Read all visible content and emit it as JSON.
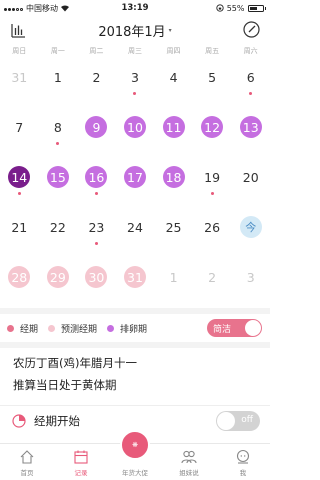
{
  "status_bar": {
    "carrier": "中国移动",
    "time": "13:19",
    "battery": "55%"
  },
  "header": {
    "title": "2018年1月",
    "caret": "▾"
  },
  "weekdays": [
    "周日",
    "周一",
    "周二",
    "周三",
    "周四",
    "周五",
    "周六"
  ],
  "calendar": {
    "weeks": [
      [
        {
          "day": "31",
          "type": "other",
          "dot": false
        },
        {
          "day": "1",
          "type": "normal",
          "dot": false
        },
        {
          "day": "2",
          "type": "normal",
          "dot": false
        },
        {
          "day": "3",
          "type": "normal",
          "dot": true
        },
        {
          "day": "4",
          "type": "normal",
          "dot": false
        },
        {
          "day": "5",
          "type": "normal",
          "dot": false
        },
        {
          "day": "6",
          "type": "normal",
          "dot": true
        }
      ],
      [
        {
          "day": "7",
          "type": "normal",
          "dot": false
        },
        {
          "day": "8",
          "type": "normal",
          "dot": true
        },
        {
          "day": "9",
          "type": "ovul",
          "dot": false
        },
        {
          "day": "10",
          "type": "ovul",
          "dot": false
        },
        {
          "day": "11",
          "type": "ovul",
          "dot": false
        },
        {
          "day": "12",
          "type": "ovul",
          "dot": false
        },
        {
          "day": "13",
          "type": "ovul",
          "dot": false
        }
      ],
      [
        {
          "day": "14",
          "type": "ovul-dark",
          "dot": true
        },
        {
          "day": "15",
          "type": "ovul",
          "dot": false
        },
        {
          "day": "16",
          "type": "ovul",
          "dot": true
        },
        {
          "day": "17",
          "type": "ovul",
          "dot": false
        },
        {
          "day": "18",
          "type": "ovul",
          "dot": false
        },
        {
          "day": "19",
          "type": "normal",
          "dot": true
        },
        {
          "day": "20",
          "type": "normal",
          "dot": false
        }
      ],
      [
        {
          "day": "21",
          "type": "normal",
          "dot": false
        },
        {
          "day": "22",
          "type": "normal",
          "dot": false
        },
        {
          "day": "23",
          "type": "normal",
          "dot": true
        },
        {
          "day": "24",
          "type": "normal",
          "dot": false
        },
        {
          "day": "25",
          "type": "normal",
          "dot": false
        },
        {
          "day": "26",
          "type": "normal",
          "dot": false
        },
        {
          "day": "今",
          "type": "today",
          "dot": false
        }
      ],
      [
        {
          "day": "28",
          "type": "period",
          "dot": false
        },
        {
          "day": "29",
          "type": "period",
          "dot": false
        },
        {
          "day": "30",
          "type": "period",
          "dot": false
        },
        {
          "day": "31",
          "type": "period",
          "dot": false
        },
        {
          "day": "1",
          "type": "other",
          "dot": false
        },
        {
          "day": "2",
          "type": "other",
          "dot": false
        },
        {
          "day": "3",
          "type": "other",
          "dot": false
        }
      ]
    ]
  },
  "legend": {
    "items": [
      {
        "label": "经期",
        "color": "#e8738d"
      },
      {
        "label": "预测经期",
        "color": "#f5c6cf"
      },
      {
        "label": "排卵期",
        "color": "#c56ee0"
      }
    ],
    "toggle_label": "简洁"
  },
  "info": {
    "line1": "农历丁酉(鸡)年腊月十一",
    "line2": "推算当日处于黄体期"
  },
  "period_start": {
    "label": "经期开始",
    "toggle_label": "off"
  },
  "tabs": [
    {
      "label": "首页",
      "icon": "home-icon",
      "active": false
    },
    {
      "label": "记录",
      "icon": "record-icon",
      "active": true
    },
    {
      "label": "年货大促",
      "icon": "promo-icon",
      "active": false
    },
    {
      "label": "姐妹说",
      "icon": "sisters-icon",
      "active": false
    },
    {
      "label": "我",
      "icon": "profile-icon",
      "active": false
    }
  ],
  "colors": {
    "accent": "#e85a7a",
    "ovulation": "#c56ee0",
    "ovulation_dark": "#7a1e8c",
    "predicted_period": "#f5c6cf",
    "today": "#d3e9f6"
  }
}
